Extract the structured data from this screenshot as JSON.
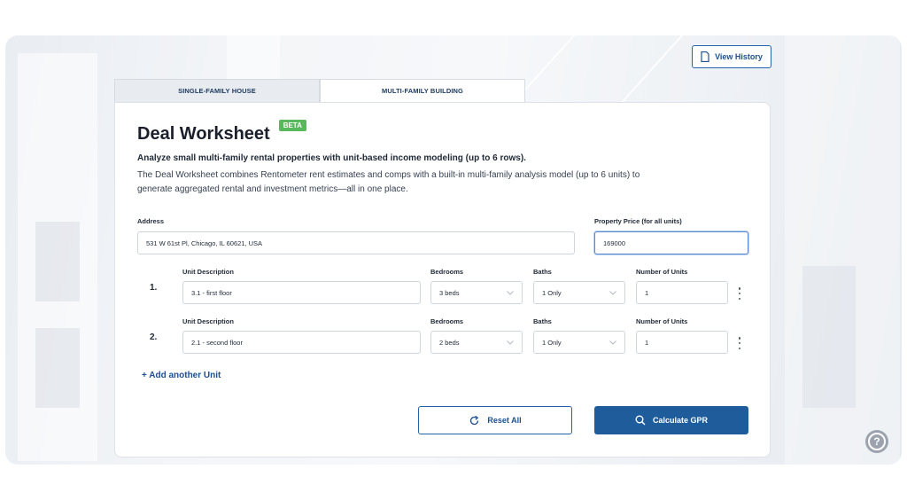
{
  "header": {
    "view_history_label": "View History"
  },
  "tabs": [
    {
      "label": "SINGLE-FAMILY HOUSE",
      "active": false
    },
    {
      "label": "MULTI-FAMILY BUILDING",
      "active": true
    }
  ],
  "worksheet": {
    "title": "Deal Worksheet",
    "badge": "BETA",
    "lead": "Analyze small multi-family rental properties with unit-based income modeling (up to 6 rows).",
    "description": "The Deal Worksheet combines Rentometer rent estimates and comps with a built-in multi-family analysis model (up to 6 units) to generate aggregated rental and investment metrics—all in one place."
  },
  "address": {
    "label": "Address",
    "value": "531 W 61st Pl, Chicago, IL 60621, USA"
  },
  "price": {
    "label": "Property Price (for all units)",
    "value": "169000"
  },
  "units": [
    {
      "number": "1.",
      "description_label": "Unit Description",
      "description": "3.1 - first floor",
      "bedrooms_label": "Bedrooms",
      "bedrooms": "3 beds",
      "baths_label": "Baths",
      "baths": "1 Only",
      "count_label": "Number of Units",
      "count": "1"
    },
    {
      "number": "2.",
      "description_label": "Unit Description",
      "description": "2.1 - second floor",
      "bedrooms_label": "Bedrooms",
      "bedrooms": "2 beds",
      "baths_label": "Baths",
      "baths": "1 Only",
      "count_label": "Number of Units",
      "count": "1"
    }
  ],
  "actions": {
    "add_unit": "+ Add another Unit",
    "reset": "Reset All",
    "calculate": "Calculate GPR"
  },
  "help": {
    "glyph": "?"
  },
  "colors": {
    "primary": "#1f5c9c",
    "beta": "#58b85c",
    "link": "#1d4f91"
  },
  "icons": [
    "document-icon",
    "chevron-down-icon",
    "kebab-menu-icon",
    "reset-icon",
    "search-icon",
    "help-icon"
  ]
}
